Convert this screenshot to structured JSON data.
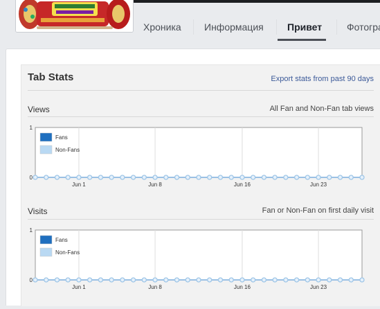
{
  "tabs": [
    {
      "label": "Хроника",
      "active": false
    },
    {
      "label": "Информация",
      "active": false
    },
    {
      "label": "Привет",
      "active": true
    },
    {
      "label": "Фотограф",
      "active": false
    }
  ],
  "tab_stats": {
    "title": "Tab Stats",
    "export_label": "Export stats from past 90 days"
  },
  "sections": [
    {
      "title": "Views",
      "subtitle": "All Fan and Non-Fan tab views"
    },
    {
      "title": "Visits",
      "subtitle": "Fan or Non-Fan on first daily visit"
    }
  ],
  "colors": {
    "fans": "#1f6fbf",
    "non_fans": "#b9d9f3",
    "line": "#9fc6e7",
    "accent_link": "#3b5998"
  },
  "chart_data": [
    {
      "type": "line",
      "ylim": [
        0,
        1
      ],
      "y_ticks": [
        "0",
        "1"
      ],
      "x_tick_labels": [
        "Jun 1",
        "Jun 8",
        "Jun 16",
        "Jun 23"
      ],
      "series": [
        {
          "name": "Fans",
          "values": [
            0,
            0,
            0,
            0,
            0,
            0,
            0,
            0,
            0,
            0,
            0,
            0,
            0,
            0,
            0,
            0,
            0,
            0,
            0,
            0,
            0,
            0,
            0,
            0,
            0,
            0,
            0,
            0,
            0,
            0,
            0
          ]
        },
        {
          "name": "Non-Fans",
          "values": [
            0,
            0,
            0,
            0,
            0,
            0,
            0,
            0,
            0,
            0,
            0,
            0,
            0,
            0,
            0,
            0,
            0,
            0,
            0,
            0,
            0,
            0,
            0,
            0,
            0,
            0,
            0,
            0,
            0,
            0,
            0
          ]
        }
      ]
    },
    {
      "type": "line",
      "ylim": [
        0,
        1
      ],
      "y_ticks": [
        "0",
        "1"
      ],
      "x_tick_labels": [
        "Jun 1",
        "Jun 8",
        "Jun 16",
        "Jun 23"
      ],
      "series": [
        {
          "name": "Fans",
          "values": [
            0,
            0,
            0,
            0,
            0,
            0,
            0,
            0,
            0,
            0,
            0,
            0,
            0,
            0,
            0,
            0,
            0,
            0,
            0,
            0,
            0,
            0,
            0,
            0,
            0,
            0,
            0,
            0,
            0,
            0,
            0
          ]
        },
        {
          "name": "Non-Fans",
          "values": [
            0,
            0,
            0,
            0,
            0,
            0,
            0,
            0,
            0,
            0,
            0,
            0,
            0,
            0,
            0,
            0,
            0,
            0,
            0,
            0,
            0,
            0,
            0,
            0,
            0,
            0,
            0,
            0,
            0,
            0,
            0
          ]
        }
      ]
    }
  ]
}
